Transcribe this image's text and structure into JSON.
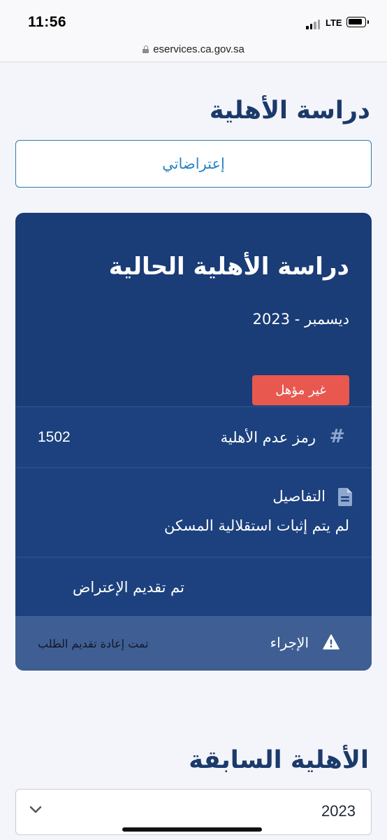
{
  "status_bar": {
    "time": "11:56",
    "network": "LTE"
  },
  "browser": {
    "url": "eservices.ca.gov.sa"
  },
  "page": {
    "title": "دراسة الأهلية",
    "objections_button": "إعتراضاتي"
  },
  "current_card": {
    "title": "دراسة الأهلية الحالية",
    "date": "ديسمبر - 2023",
    "status_badge": "غير مؤهل",
    "ineligibility_code_label": "رمز عدم الأهلية",
    "ineligibility_code_value": "1502",
    "details_label": "التفاصيل",
    "details_text": "لم يتم إثبات استقلالية المسكن",
    "objection_status": "تم تقديم الإعتراض",
    "action_label": "الإجراء",
    "action_value": "تمت إعادة تقديم الطلب",
    "badge_color": "#e8584f",
    "card_color": "#1a3c77"
  },
  "previous": {
    "title": "الأهلية السابقة",
    "selected_year": "2023"
  }
}
